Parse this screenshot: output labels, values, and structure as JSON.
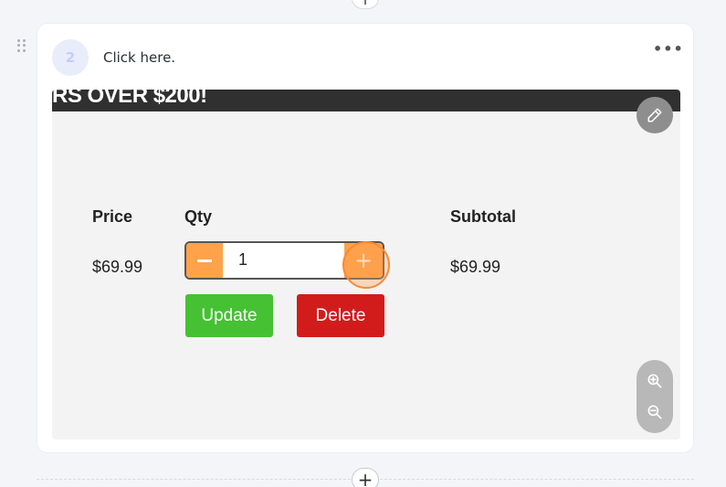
{
  "step": {
    "number": "2",
    "instruction": "Click here.",
    "more_label": "•••"
  },
  "screenshot": {
    "banner_text": "RS OVER $200!",
    "columns": {
      "price": "Price",
      "qty": "Qty",
      "subtotal": "Subtotal"
    },
    "row": {
      "price": "$69.99",
      "qty_value": "1",
      "subtotal": "$69.99"
    },
    "buttons": {
      "minus": "−",
      "plus": "+",
      "update": "Update",
      "delete": "Delete"
    }
  },
  "controls": {
    "add_step_top": "+",
    "add_step_bottom": "+"
  },
  "icons": [
    "drag-handle-icon",
    "more-icon",
    "pencil-icon",
    "zoom-in-icon",
    "zoom-out-icon",
    "plus-icon",
    "minus-icon"
  ],
  "colors": {
    "accent_orange": "#ffa24a",
    "update_green": "#45c133",
    "delete_red": "#d21c1c",
    "banner": "#303030"
  }
}
